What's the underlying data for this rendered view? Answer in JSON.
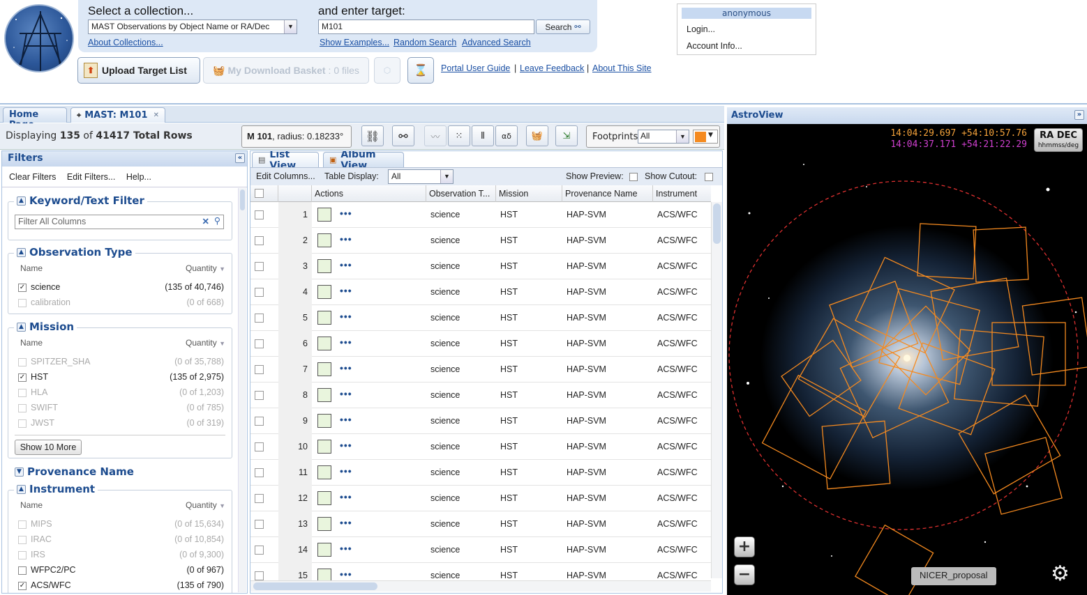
{
  "header": {
    "select_collection_label": "Select a collection...",
    "collection_value": "MAST Observations by Object Name or RA/Dec",
    "enter_target_label": "and enter target:",
    "target_value": "M101",
    "search_label": "Search",
    "about_collections": "About Collections...",
    "show_examples": "Show Examples...",
    "random_search": "Random Search",
    "advanced_search": "Advanced Search",
    "upload_target_list": "Upload Target List",
    "download_basket": "My Download Basket",
    "download_basket_count": ": 0 files",
    "portal_user_guide": "Portal User Guide",
    "leave_feedback": "Leave Feedback",
    "about_site": "About This Site",
    "separator": "|"
  },
  "user": {
    "name": "anonymous",
    "login": "Login...",
    "account": "Account Info..."
  },
  "tabs": {
    "home": "Home Page",
    "mast": "MAST: M101"
  },
  "infobar": {
    "displaying_prefix": "Displaying",
    "shown": "135",
    "of": "of",
    "total": "41417 Total Rows",
    "target_name": "M 101",
    "radius": ", radius: 0.18233°",
    "footprints_label": "Footprints:",
    "footprints_value": "All",
    "footprint_color": "#f58a1f"
  },
  "filters": {
    "title": "Filters",
    "clear": "Clear Filters",
    "edit": "Edit Filters...",
    "help": "Help...",
    "keyword": {
      "title": "Keyword/Text Filter",
      "placeholder": "Filter All Columns"
    },
    "col_name": "Name",
    "col_quantity": "Quantity",
    "observation_type": {
      "title": "Observation Type",
      "items": [
        {
          "name": "science",
          "qty": "(135 of 40,746)",
          "checked": true
        },
        {
          "name": "calibration",
          "qty": "(0 of 668)",
          "checked": false
        }
      ]
    },
    "mission": {
      "title": "Mission",
      "items": [
        {
          "name": "SPITZER_SHA",
          "qty": "(0 of 35,788)"
        },
        {
          "name": "HST",
          "qty": "(135 of 2,975)"
        },
        {
          "name": "HLA",
          "qty": "(0 of 1,203)"
        },
        {
          "name": "SWIFT",
          "qty": "(0 of 785)"
        },
        {
          "name": "JWST",
          "qty": "(0 of 319)"
        }
      ],
      "more": "Show 10 More"
    },
    "provenance": {
      "title": "Provenance Name"
    },
    "instrument": {
      "title": "Instrument",
      "items": [
        {
          "name": "MIPS",
          "qty": "(0 of 15,634)"
        },
        {
          "name": "IRAC",
          "qty": "(0 of 10,854)"
        },
        {
          "name": "IRS",
          "qty": "(0 of 9,300)"
        },
        {
          "name": "WFPC2/PC",
          "qty": "(0 of 967)"
        },
        {
          "name": "ACS/WFC",
          "qty": "(135 of 790)"
        }
      ]
    }
  },
  "table": {
    "list_view": "List View",
    "album_view": "Album View",
    "edit_columns": "Edit Columns...",
    "table_display_label": "Table Display:",
    "table_display_value": "All",
    "show_preview": "Show Preview:",
    "show_cutout": "Show Cutout:",
    "columns": [
      "Actions",
      "Observation T...",
      "Mission",
      "Provenance Name",
      "Instrument"
    ],
    "dots": "•••",
    "rows": [
      {
        "n": "1",
        "type": "science",
        "mission": "HST",
        "prov": "HAP-SVM",
        "inst": "ACS/WFC"
      },
      {
        "n": "2",
        "type": "science",
        "mission": "HST",
        "prov": "HAP-SVM",
        "inst": "ACS/WFC"
      },
      {
        "n": "3",
        "type": "science",
        "mission": "HST",
        "prov": "HAP-SVM",
        "inst": "ACS/WFC"
      },
      {
        "n": "4",
        "type": "science",
        "mission": "HST",
        "prov": "HAP-SVM",
        "inst": "ACS/WFC"
      },
      {
        "n": "5",
        "type": "science",
        "mission": "HST",
        "prov": "HAP-SVM",
        "inst": "ACS/WFC"
      },
      {
        "n": "6",
        "type": "science",
        "mission": "HST",
        "prov": "HAP-SVM",
        "inst": "ACS/WFC"
      },
      {
        "n": "7",
        "type": "science",
        "mission": "HST",
        "prov": "HAP-SVM",
        "inst": "ACS/WFC"
      },
      {
        "n": "8",
        "type": "science",
        "mission": "HST",
        "prov": "HAP-SVM",
        "inst": "ACS/WFC"
      },
      {
        "n": "9",
        "type": "science",
        "mission": "HST",
        "prov": "HAP-SVM",
        "inst": "ACS/WFC"
      },
      {
        "n": "10",
        "type": "science",
        "mission": "HST",
        "prov": "HAP-SVM",
        "inst": "ACS/WFC"
      },
      {
        "n": "11",
        "type": "science",
        "mission": "HST",
        "prov": "HAP-SVM",
        "inst": "ACS/WFC"
      },
      {
        "n": "12",
        "type": "science",
        "mission": "HST",
        "prov": "HAP-SVM",
        "inst": "ACS/WFC"
      },
      {
        "n": "13",
        "type": "science",
        "mission": "HST",
        "prov": "HAP-SVM",
        "inst": "ACS/WFC"
      },
      {
        "n": "14",
        "type": "science",
        "mission": "HST",
        "prov": "HAP-SVM",
        "inst": "ACS/WFC"
      },
      {
        "n": "15",
        "type": "science",
        "mission": "HST",
        "prov": "HAP-SVM",
        "inst": "ACS/WFC"
      }
    ]
  },
  "astroview": {
    "title": "AstroView",
    "coord1": "14:04:29.697 +54:10:57.76",
    "coord1_color": "#f5a23a",
    "coord2": "14:04:37.171 +54:21:22.29",
    "coord2_color": "#d040d0",
    "radec_label": "RA DEC",
    "radec_format": "hhmmss/deg",
    "footprint_label": "NICER_proposal",
    "zoom_in": "+",
    "zoom_out": "−"
  }
}
